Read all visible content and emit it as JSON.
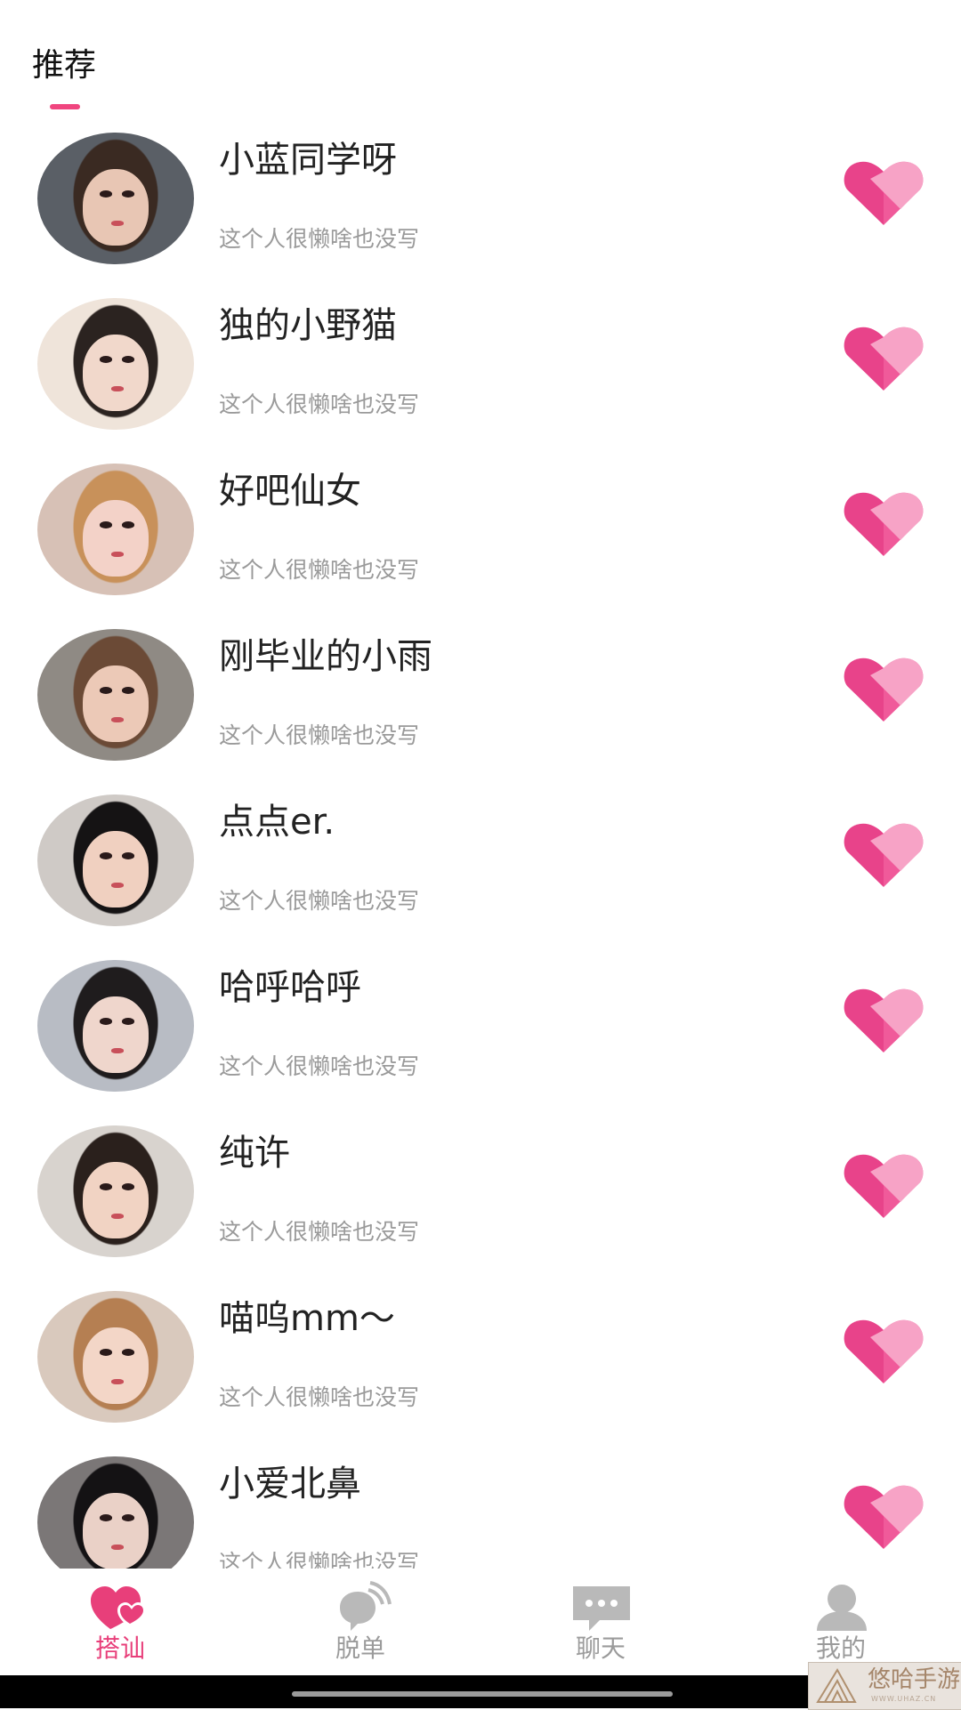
{
  "header": {
    "tab_title": "推荐",
    "accent": "#f0457f"
  },
  "users": [
    {
      "name": "小蓝同学呀",
      "signature": "这个人很懒啥也没写",
      "avatar_tone": "#e8c6b4",
      "hair_tone": "#3a2a22",
      "bg_tone": "#5a5f66"
    },
    {
      "name": "独的小野猫",
      "signature": "这个人很懒啥也没写",
      "avatar_tone": "#f1d8cb",
      "hair_tone": "#2b2320",
      "bg_tone": "#efe4da"
    },
    {
      "name": "好吧仙女",
      "signature": "这个人很懒啥也没写",
      "avatar_tone": "#f3d2c8",
      "hair_tone": "#c8915a",
      "bg_tone": "#d7c1b6"
    },
    {
      "name": "刚毕业的小雨",
      "signature": "这个人很懒啥也没写",
      "avatar_tone": "#ecc9b7",
      "hair_tone": "#6b4a36",
      "bg_tone": "#8f8a84"
    },
    {
      "name": "点点er.",
      "signature": "这个人很懒啥也没写",
      "avatar_tone": "#f0d0c0",
      "hair_tone": "#151314",
      "bg_tone": "#cfcac6"
    },
    {
      "name": "哈呼哈呼",
      "signature": "这个人很懒啥也没写",
      "avatar_tone": "#efd6cc",
      "hair_tone": "#1f1c1d",
      "bg_tone": "#b8bcc4"
    },
    {
      "name": "纯许",
      "signature": "这个人很懒啥也没写",
      "avatar_tone": "#f1d3c3",
      "hair_tone": "#2a201c",
      "bg_tone": "#d8d3ce"
    },
    {
      "name": "喵呜mm～",
      "signature": "这个人很懒啥也没写",
      "avatar_tone": "#f3d6c7",
      "hair_tone": "#b57f52",
      "bg_tone": "#d9c9bd"
    },
    {
      "name": "小爱北鼻",
      "signature": "这个人很懒啥也没写",
      "avatar_tone": "#ead1c7",
      "hair_tone": "#141214",
      "bg_tone": "#7b7777"
    }
  ],
  "tabbar": {
    "active_color": "#e83f7a",
    "inactive_color": "#9b9b9b",
    "icon_inactive": "#b9b9b9",
    "tabs": [
      {
        "label": "搭讪",
        "icon": "hearts-icon",
        "active": true
      },
      {
        "label": "脱单",
        "icon": "signal-bubble-icon",
        "active": false
      },
      {
        "label": "聊天",
        "icon": "chat-bubble-icon",
        "active": false
      },
      {
        "label": "我的",
        "icon": "person-icon",
        "active": false
      }
    ]
  },
  "watermark": {
    "text": "悠哈手游",
    "sub": "WWW.UHAZ.CN"
  }
}
